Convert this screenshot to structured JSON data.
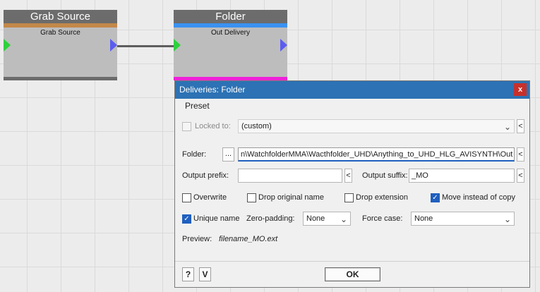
{
  "nodes": {
    "grab": {
      "title": "Grab Source",
      "subtitle": "Grab Source",
      "band_color": "#c38849",
      "foot_color": "#6c6c6c"
    },
    "folder": {
      "title": "Folder",
      "subtitle": "Out Delivery",
      "band_color": "#3a92f0",
      "foot_color": "#ee22d8"
    }
  },
  "dialog": {
    "title": "Deliveries: Folder",
    "close_label": "x",
    "menu": {
      "preset": "Preset"
    },
    "locked_to": {
      "label": "Locked to:",
      "checked": false,
      "enabled": false,
      "value": "(custom)"
    },
    "folder": {
      "label": "Folder:",
      "browse_label": "...",
      "value": "n\\WatchfolderMMA\\Wacthfolder_UHD\\Anything_to_UHD_HLG_AVISYNTH\\Out"
    },
    "output_prefix": {
      "label": "Output prefix:",
      "value": ""
    },
    "output_suffix": {
      "label": "Output suffix:",
      "value": "_MO"
    },
    "options": {
      "overwrite": {
        "label": "Overwrite",
        "checked": false
      },
      "drop_original_name": {
        "label": "Drop original name",
        "checked": false
      },
      "drop_extension": {
        "label": "Drop extension",
        "checked": false
      },
      "move_instead_of_copy": {
        "label": "Move instead of copy",
        "checked": true
      },
      "unique_name": {
        "label": "Unique name",
        "checked": true
      }
    },
    "zero_padding": {
      "label": "Zero-padding:",
      "value": "None"
    },
    "force_case": {
      "label": "Force case:",
      "value": "None"
    },
    "preview": {
      "label": "Preview:",
      "value": "filename_MO.ext"
    },
    "footer": {
      "help_label": "?",
      "v_label": "V",
      "ok_label": "OK"
    }
  },
  "glyphs": {
    "chevron_down": "⌄",
    "chevron_left": "<",
    "check": "✓"
  }
}
